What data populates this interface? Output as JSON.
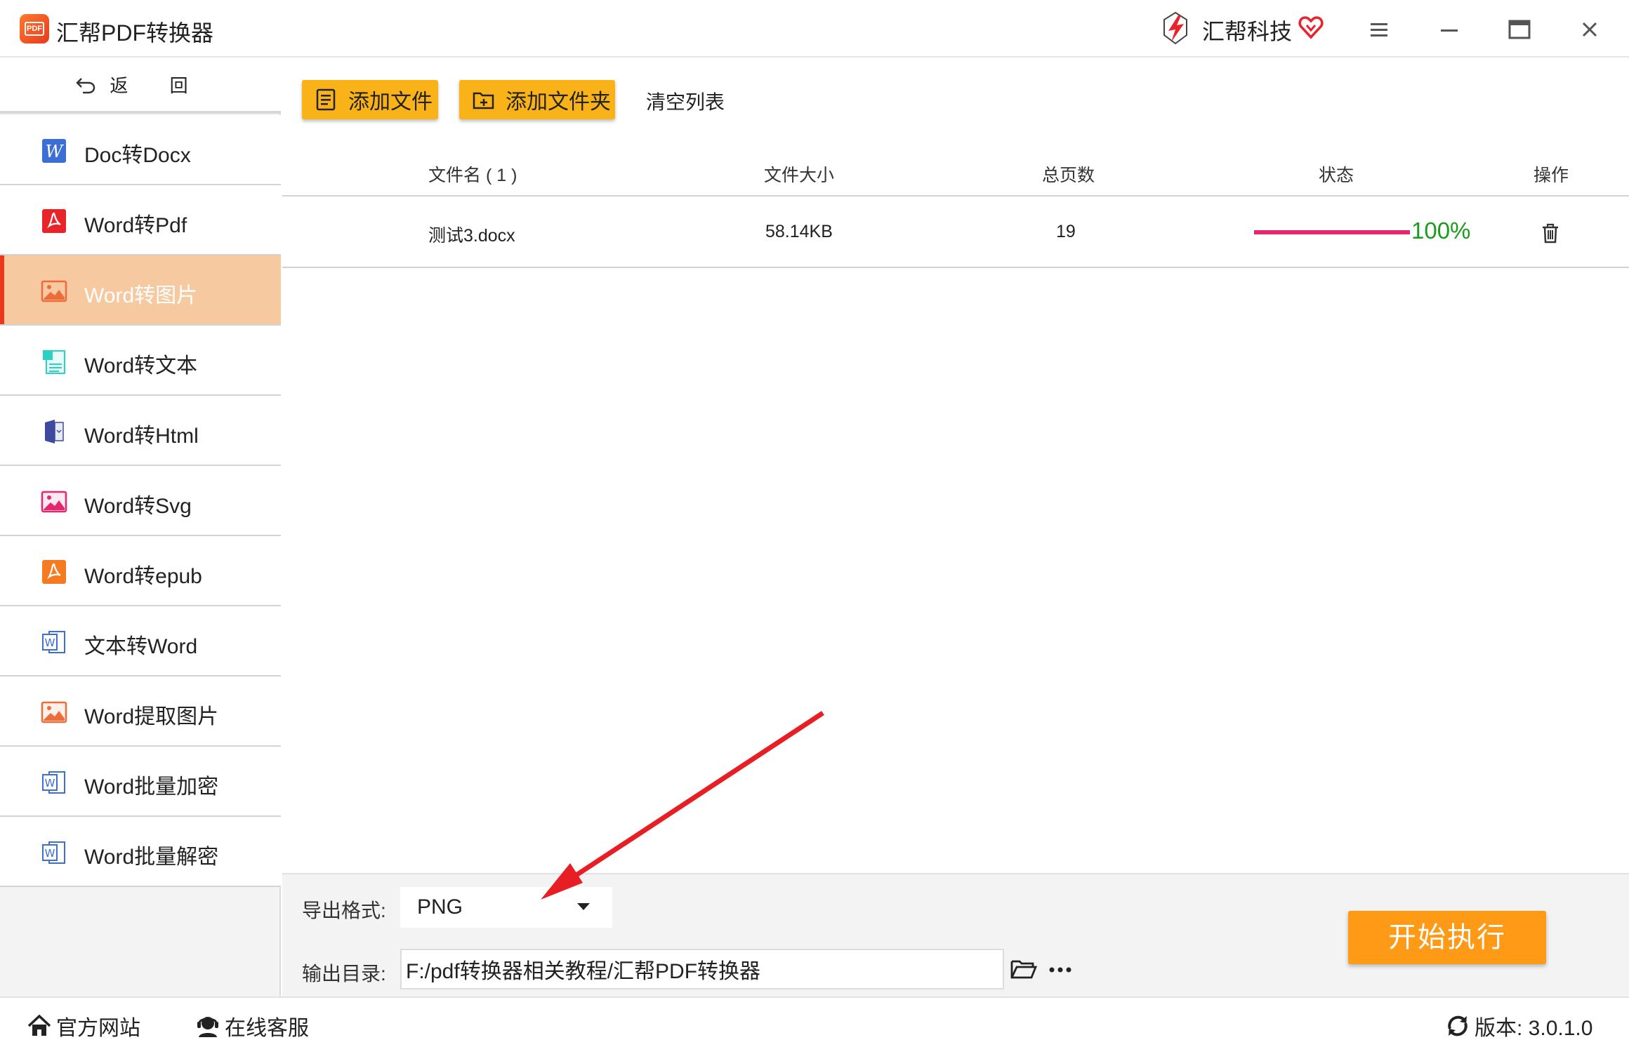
{
  "titlebar": {
    "app_title": "汇帮PDF转换器",
    "brand_name": "汇帮科技"
  },
  "sidebar": {
    "back_label": "返 回",
    "items": [
      {
        "label": "Doc转Docx",
        "icon": "word-w-icon"
      },
      {
        "label": "Word转Pdf",
        "icon": "pdf-icon"
      },
      {
        "label": "Word转图片",
        "icon": "image-icon",
        "active": true
      },
      {
        "label": "Word转文本",
        "icon": "text-doc-icon"
      },
      {
        "label": "Word转Html",
        "icon": "html-doc-icon"
      },
      {
        "label": "Word转Svg",
        "icon": "svg-image-icon"
      },
      {
        "label": "Word转epub",
        "icon": "epub-icon"
      },
      {
        "label": "文本转Word",
        "icon": "word-doc-icon"
      },
      {
        "label": "Word提取图片",
        "icon": "extract-image-icon"
      },
      {
        "label": "Word批量加密",
        "icon": "word-doc-icon"
      },
      {
        "label": "Word批量解密",
        "icon": "word-doc-icon"
      }
    ]
  },
  "toolbar": {
    "add_file": "添加文件",
    "add_folder": "添加文件夹",
    "clear_list": "清空列表"
  },
  "table": {
    "headers": {
      "filename": "文件名 ( 1 )",
      "size": "文件大小",
      "pages": "总页数",
      "status": "状态",
      "action": "操作"
    },
    "rows": [
      {
        "filename": "测试3.docx",
        "size": "58.14KB",
        "pages": "19",
        "progress": 1.0,
        "progress_text": "100%"
      }
    ]
  },
  "settings": {
    "format_label": "导出格式:",
    "format_value": "PNG",
    "dir_label": "输出目录:",
    "dir_value": "F:/pdf转换器相关教程/汇帮PDF转换器",
    "start_button": "开始执行"
  },
  "statusbar": {
    "website": "官方网站",
    "support": "在线客服",
    "version": "版本: 3.0.1.0"
  },
  "colors": {
    "accent_yellow": "#f9b218",
    "start_orange": "#ff9a16",
    "active_item_bg": "#f7c9a1",
    "progress_pink": "#e6266e",
    "progress_text_green": "#1a9b1a",
    "annotation_red": "#e81e25"
  }
}
